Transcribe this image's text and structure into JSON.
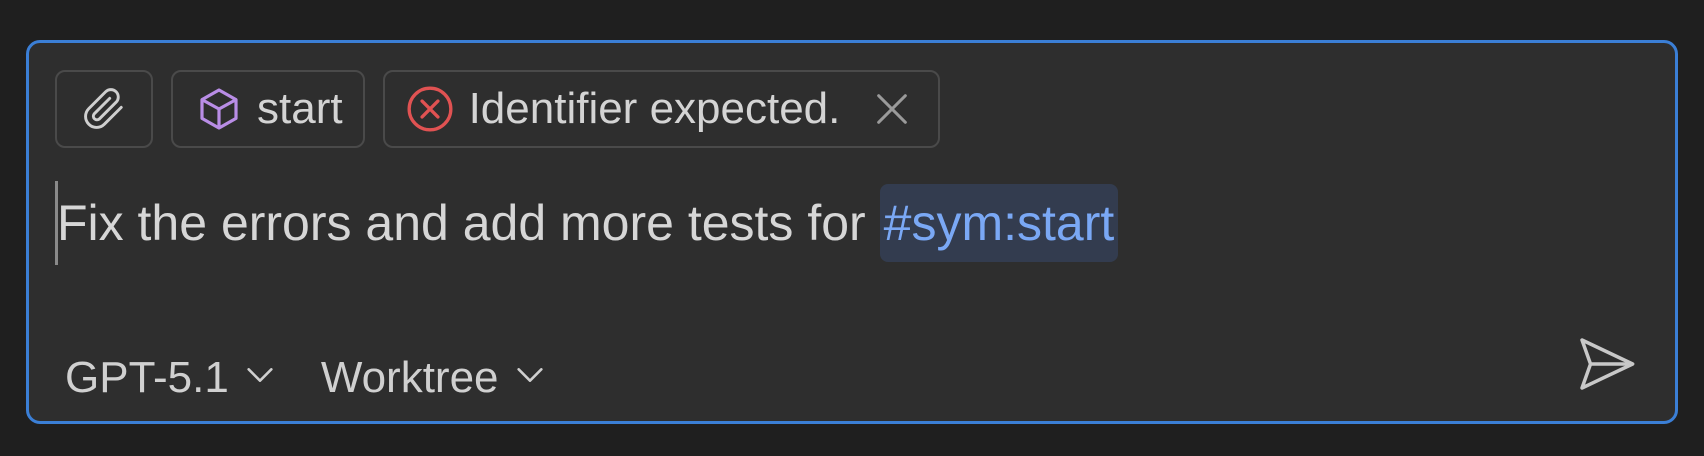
{
  "context_chips": {
    "attach_icon": "paperclip-icon",
    "symbol": {
      "icon": "cube-icon",
      "label": "start",
      "icon_color": "#b98de6"
    },
    "error": {
      "icon": "error-circle-icon",
      "label": "Identifier expected.",
      "icon_color": "#e05252",
      "remove_icon": "close-icon"
    }
  },
  "prompt": {
    "text": "Fix the errors and add more tests for",
    "mention": "#sym:start"
  },
  "footer": {
    "model_label": "GPT-5.1",
    "mode_label": "Worktree",
    "dropdown_icon": "chevron-down-icon",
    "send_icon": "send-icon"
  },
  "colors": {
    "background": "#1f1f1f",
    "panel": "#2e2e2e",
    "focus_border": "#3b7fd6",
    "mention_text": "#7aa8f5",
    "mention_bg": "#333c4f"
  }
}
